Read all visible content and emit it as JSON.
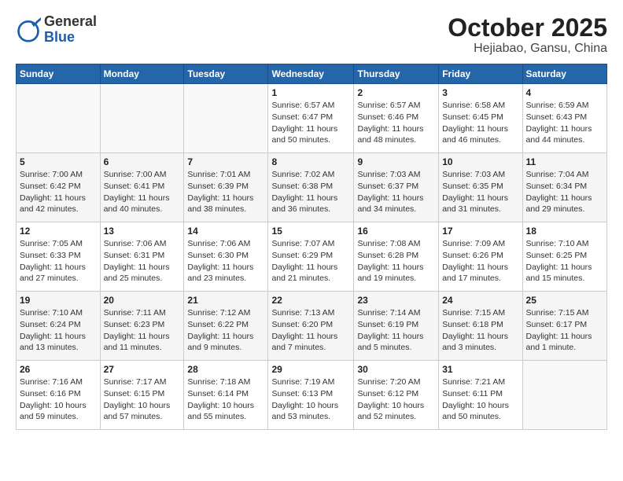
{
  "header": {
    "logo_general": "General",
    "logo_blue": "Blue",
    "title": "October 2025",
    "subtitle": "Hejiabao, Gansu, China"
  },
  "days_of_week": [
    "Sunday",
    "Monday",
    "Tuesday",
    "Wednesday",
    "Thursday",
    "Friday",
    "Saturday"
  ],
  "weeks": [
    [
      {
        "day": "",
        "detail": ""
      },
      {
        "day": "",
        "detail": ""
      },
      {
        "day": "",
        "detail": ""
      },
      {
        "day": "1",
        "detail": "Sunrise: 6:57 AM\nSunset: 6:47 PM\nDaylight: 11 hours\nand 50 minutes."
      },
      {
        "day": "2",
        "detail": "Sunrise: 6:57 AM\nSunset: 6:46 PM\nDaylight: 11 hours\nand 48 minutes."
      },
      {
        "day": "3",
        "detail": "Sunrise: 6:58 AM\nSunset: 6:45 PM\nDaylight: 11 hours\nand 46 minutes."
      },
      {
        "day": "4",
        "detail": "Sunrise: 6:59 AM\nSunset: 6:43 PM\nDaylight: 11 hours\nand 44 minutes."
      }
    ],
    [
      {
        "day": "5",
        "detail": "Sunrise: 7:00 AM\nSunset: 6:42 PM\nDaylight: 11 hours\nand 42 minutes."
      },
      {
        "day": "6",
        "detail": "Sunrise: 7:00 AM\nSunset: 6:41 PM\nDaylight: 11 hours\nand 40 minutes."
      },
      {
        "day": "7",
        "detail": "Sunrise: 7:01 AM\nSunset: 6:39 PM\nDaylight: 11 hours\nand 38 minutes."
      },
      {
        "day": "8",
        "detail": "Sunrise: 7:02 AM\nSunset: 6:38 PM\nDaylight: 11 hours\nand 36 minutes."
      },
      {
        "day": "9",
        "detail": "Sunrise: 7:03 AM\nSunset: 6:37 PM\nDaylight: 11 hours\nand 34 minutes."
      },
      {
        "day": "10",
        "detail": "Sunrise: 7:03 AM\nSunset: 6:35 PM\nDaylight: 11 hours\nand 31 minutes."
      },
      {
        "day": "11",
        "detail": "Sunrise: 7:04 AM\nSunset: 6:34 PM\nDaylight: 11 hours\nand 29 minutes."
      }
    ],
    [
      {
        "day": "12",
        "detail": "Sunrise: 7:05 AM\nSunset: 6:33 PM\nDaylight: 11 hours\nand 27 minutes."
      },
      {
        "day": "13",
        "detail": "Sunrise: 7:06 AM\nSunset: 6:31 PM\nDaylight: 11 hours\nand 25 minutes."
      },
      {
        "day": "14",
        "detail": "Sunrise: 7:06 AM\nSunset: 6:30 PM\nDaylight: 11 hours\nand 23 minutes."
      },
      {
        "day": "15",
        "detail": "Sunrise: 7:07 AM\nSunset: 6:29 PM\nDaylight: 11 hours\nand 21 minutes."
      },
      {
        "day": "16",
        "detail": "Sunrise: 7:08 AM\nSunset: 6:28 PM\nDaylight: 11 hours\nand 19 minutes."
      },
      {
        "day": "17",
        "detail": "Sunrise: 7:09 AM\nSunset: 6:26 PM\nDaylight: 11 hours\nand 17 minutes."
      },
      {
        "day": "18",
        "detail": "Sunrise: 7:10 AM\nSunset: 6:25 PM\nDaylight: 11 hours\nand 15 minutes."
      }
    ],
    [
      {
        "day": "19",
        "detail": "Sunrise: 7:10 AM\nSunset: 6:24 PM\nDaylight: 11 hours\nand 13 minutes."
      },
      {
        "day": "20",
        "detail": "Sunrise: 7:11 AM\nSunset: 6:23 PM\nDaylight: 11 hours\nand 11 minutes."
      },
      {
        "day": "21",
        "detail": "Sunrise: 7:12 AM\nSunset: 6:22 PM\nDaylight: 11 hours\nand 9 minutes."
      },
      {
        "day": "22",
        "detail": "Sunrise: 7:13 AM\nSunset: 6:20 PM\nDaylight: 11 hours\nand 7 minutes."
      },
      {
        "day": "23",
        "detail": "Sunrise: 7:14 AM\nSunset: 6:19 PM\nDaylight: 11 hours\nand 5 minutes."
      },
      {
        "day": "24",
        "detail": "Sunrise: 7:15 AM\nSunset: 6:18 PM\nDaylight: 11 hours\nand 3 minutes."
      },
      {
        "day": "25",
        "detail": "Sunrise: 7:15 AM\nSunset: 6:17 PM\nDaylight: 11 hours\nand 1 minute."
      }
    ],
    [
      {
        "day": "26",
        "detail": "Sunrise: 7:16 AM\nSunset: 6:16 PM\nDaylight: 10 hours\nand 59 minutes."
      },
      {
        "day": "27",
        "detail": "Sunrise: 7:17 AM\nSunset: 6:15 PM\nDaylight: 10 hours\nand 57 minutes."
      },
      {
        "day": "28",
        "detail": "Sunrise: 7:18 AM\nSunset: 6:14 PM\nDaylight: 10 hours\nand 55 minutes."
      },
      {
        "day": "29",
        "detail": "Sunrise: 7:19 AM\nSunset: 6:13 PM\nDaylight: 10 hours\nand 53 minutes."
      },
      {
        "day": "30",
        "detail": "Sunrise: 7:20 AM\nSunset: 6:12 PM\nDaylight: 10 hours\nand 52 minutes."
      },
      {
        "day": "31",
        "detail": "Sunrise: 7:21 AM\nSunset: 6:11 PM\nDaylight: 10 hours\nand 50 minutes."
      },
      {
        "day": "",
        "detail": ""
      }
    ]
  ]
}
